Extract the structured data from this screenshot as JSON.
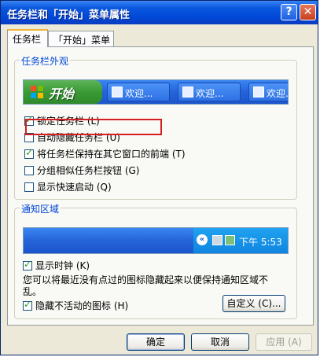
{
  "window": {
    "title": "任务栏和「开始」菜单属性",
    "help": "?",
    "close": "✕"
  },
  "tabs": [
    {
      "label": "任务栏"
    },
    {
      "label": "「开始」菜单"
    }
  ],
  "appearance": {
    "legend": "任务栏外观",
    "preview": {
      "start_label": "开始",
      "tasks": [
        "欢迎...",
        "欢迎...",
        "欢迎..."
      ]
    },
    "options": [
      {
        "label": "锁定任务栏 (L)",
        "checked": true
      },
      {
        "label": "自动隐藏任务栏 (U)",
        "checked": false
      },
      {
        "label": "将任务栏保持在其它窗口的前端 (T)",
        "checked": true
      },
      {
        "label": "分组相似任务栏按钮 (G)",
        "checked": false
      },
      {
        "label": "显示快速启动 (Q)",
        "checked": false
      }
    ]
  },
  "notification": {
    "legend": "通知区域",
    "clock_text": "下午 5:53",
    "show_clock": {
      "label": "显示时钟 (K)",
      "checked": true
    },
    "description": "您可以将最近没有点过的图标隐藏起来以便保持通知区域不乱。",
    "hide_inactive": {
      "label": "隐藏不活动的图标 (H)",
      "checked": true
    },
    "customize_label": "自定义 (C)..."
  },
  "buttons": {
    "ok": "确定",
    "cancel": "取消",
    "apply": "应用 (A)"
  },
  "colors": {
    "title_bar": "#0a58de",
    "highlight_box": "#d42020",
    "group_legend": "#0046d5"
  }
}
